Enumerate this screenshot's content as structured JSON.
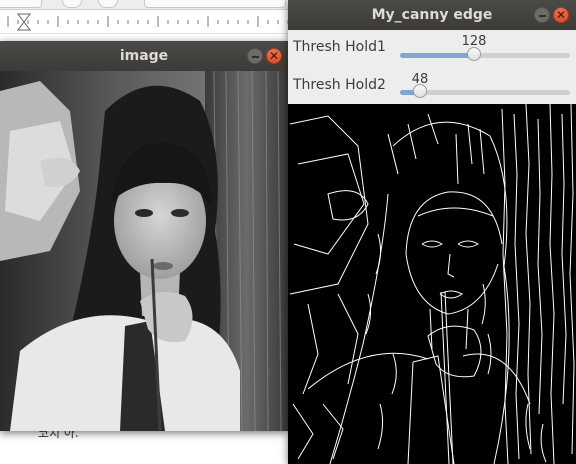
{
  "background_editor": {
    "bottom_glyph": "코치 아."
  },
  "image_window": {
    "title": "image",
    "minimize_label": "",
    "close_label": "✕"
  },
  "canny_window": {
    "title": "My_canny edge",
    "minimize_label": "",
    "close_label": "✕",
    "trackbars": [
      {
        "label": "Thresh Hold1",
        "value": "128",
        "fraction": 0.438
      },
      {
        "label": "Thresh Hold2",
        "value": "48",
        "fraction": 0.12
      }
    ]
  },
  "colors": {
    "titlebar": "#3c3b37",
    "close_button": "#e4572e",
    "slider_fill": "#7fa6d8",
    "edge_background": "#000000",
    "edge_lines": "#ffffff"
  },
  "icons": [
    "minimize-icon",
    "close-icon"
  ]
}
